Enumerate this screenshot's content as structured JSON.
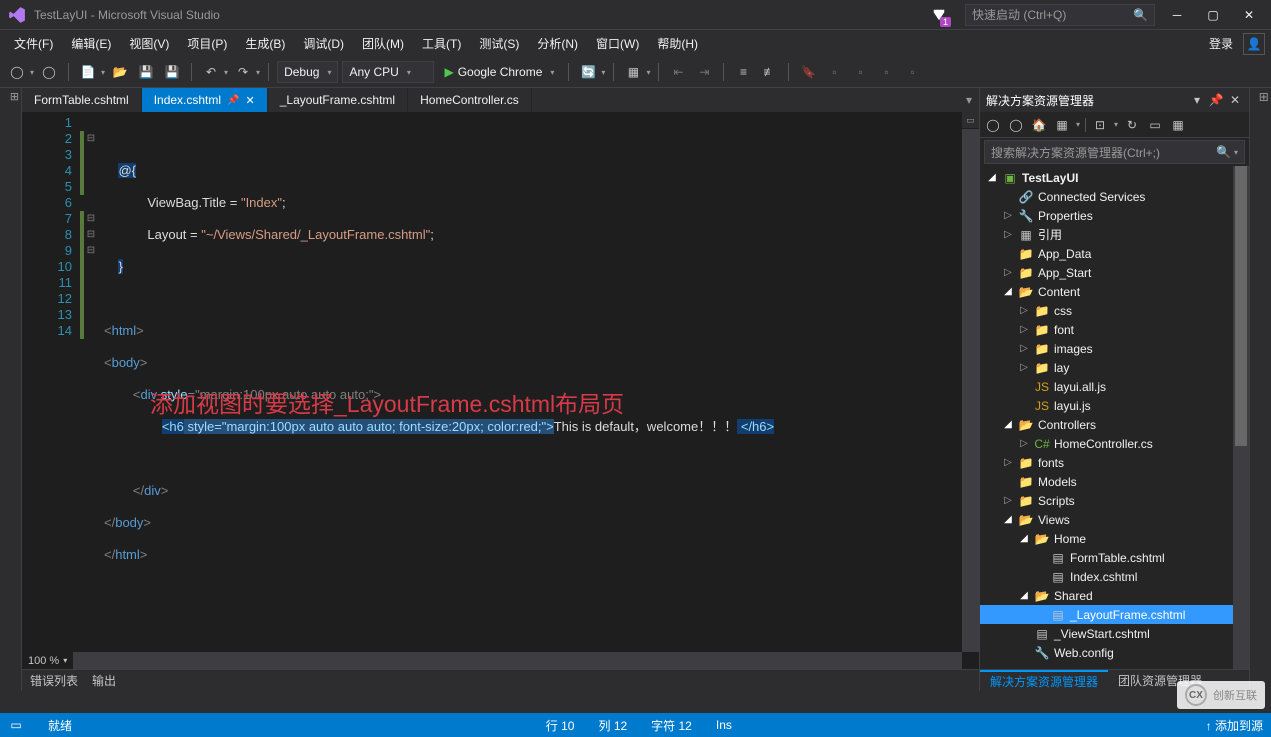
{
  "title": "TestLayUI - Microsoft Visual Studio",
  "quick_launch_placeholder": "快速启动 (Ctrl+Q)",
  "notif_count": "1",
  "menus": [
    "文件(F)",
    "编辑(E)",
    "视图(V)",
    "项目(P)",
    "生成(B)",
    "调试(D)",
    "团队(M)",
    "工具(T)",
    "测试(S)",
    "分析(N)",
    "窗口(W)",
    "帮助(H)"
  ],
  "login_label": "登录",
  "toolbar": {
    "config": "Debug",
    "platform": "Any CPU",
    "start_label": "Google Chrome"
  },
  "tabs": [
    {
      "label": "FormTable.cshtml",
      "active": false
    },
    {
      "label": "Index.cshtml",
      "active": true
    },
    {
      "label": "_LayoutFrame.cshtml",
      "active": false
    },
    {
      "label": "HomeController.cs",
      "active": false
    }
  ],
  "code": {
    "lines": [
      "1",
      "2",
      "3",
      "4",
      "5",
      "6",
      "7",
      "8",
      "9",
      "10",
      "11",
      "12",
      "13",
      "14"
    ],
    "l2_at": "@{",
    "l3_a": "ViewBag.Title = ",
    "l3_b": "\"Index\"",
    "l3_c": ";",
    "l4_a": "Layout = ",
    "l4_b": "\"~/Views/Shared/_LayoutFrame.cshtml\"",
    "l4_c": ";",
    "l5": "}",
    "l7_o": "<",
    "l7_t": "html",
    "l7_c": ">",
    "l8_o": "<",
    "l8_t": "body",
    "l8_c": ">",
    "l9_o": "<",
    "l9_t": "div",
    "l9_sp": " ",
    "l9_attr": "style",
    "l9_eq": "=",
    "l9_val": "\"margin:100px auto auto auto;\"",
    "l9_c": ">",
    "l10_open": "<h6",
    "l10_sel": " style=\"margin:100px auto auto auto; font-size:20px; color:red;\">",
    "l10_text": "This is default，welcome！！！",
    "l10_close": " </h6>",
    "l12_o": "</",
    "l12_t": "div",
    "l12_c": ">",
    "l13_o": "</",
    "l13_t": "body",
    "l13_c": ">",
    "l14_o": "</",
    "l14_t": "html",
    "l14_c": ">"
  },
  "annotation": "添加视图时要选择_LayoutFrame.cshtml布局页",
  "zoom": "100 %",
  "bottom_tabs": [
    "错误列表",
    "输出"
  ],
  "panel": {
    "title": "解决方案资源管理器",
    "search_placeholder": "搜索解决方案资源管理器(Ctrl+;)",
    "tabs": [
      "解决方案资源管理器",
      "团队资源管理器"
    ]
  },
  "tree": [
    {
      "d": 0,
      "arr": "open",
      "ico": "csproj",
      "label": "TestLayUI",
      "bold": true
    },
    {
      "d": 1,
      "arr": "",
      "ico": "conn",
      "label": "Connected Services"
    },
    {
      "d": 1,
      "arr": "closed",
      "ico": "cfg",
      "label": "Properties"
    },
    {
      "d": 1,
      "arr": "closed",
      "ico": "ref",
      "label": "引用"
    },
    {
      "d": 1,
      "arr": "",
      "ico": "folder",
      "label": "App_Data"
    },
    {
      "d": 1,
      "arr": "closed",
      "ico": "folder",
      "label": "App_Start"
    },
    {
      "d": 1,
      "arr": "open",
      "ico": "folder-o",
      "label": "Content"
    },
    {
      "d": 2,
      "arr": "closed",
      "ico": "folder",
      "label": "css"
    },
    {
      "d": 2,
      "arr": "closed",
      "ico": "folder",
      "label": "font"
    },
    {
      "d": 2,
      "arr": "closed",
      "ico": "folder",
      "label": "images"
    },
    {
      "d": 2,
      "arr": "closed",
      "ico": "folder",
      "label": "lay"
    },
    {
      "d": 2,
      "arr": "",
      "ico": "js",
      "label": "layui.all.js"
    },
    {
      "d": 2,
      "arr": "",
      "ico": "js",
      "label": "layui.js"
    },
    {
      "d": 1,
      "arr": "open",
      "ico": "folder-o",
      "label": "Controllers"
    },
    {
      "d": 2,
      "arr": "closed",
      "ico": "cs",
      "label": "HomeController.cs"
    },
    {
      "d": 1,
      "arr": "closed",
      "ico": "folder",
      "label": "fonts"
    },
    {
      "d": 1,
      "arr": "",
      "ico": "folder",
      "label": "Models"
    },
    {
      "d": 1,
      "arr": "closed",
      "ico": "folder",
      "label": "Scripts"
    },
    {
      "d": 1,
      "arr": "open",
      "ico": "folder-o",
      "label": "Views"
    },
    {
      "d": 2,
      "arr": "open",
      "ico": "folder-o",
      "label": "Home"
    },
    {
      "d": 3,
      "arr": "",
      "ico": "view",
      "label": "FormTable.cshtml"
    },
    {
      "d": 3,
      "arr": "",
      "ico": "view",
      "label": "Index.cshtml"
    },
    {
      "d": 2,
      "arr": "open",
      "ico": "folder-o",
      "label": "Shared"
    },
    {
      "d": 3,
      "arr": "",
      "ico": "view",
      "label": "_LayoutFrame.cshtml",
      "sel": true
    },
    {
      "d": 2,
      "arr": "",
      "ico": "view",
      "label": "_ViewStart.cshtml"
    },
    {
      "d": 2,
      "arr": "",
      "ico": "cfg",
      "label": "Web.config"
    }
  ],
  "status": {
    "ready": "就绪",
    "line": "行 10",
    "col": "列 12",
    "char": "字符 12",
    "ins": "Ins",
    "publish": "添加到源"
  },
  "watermark": "创新互联"
}
